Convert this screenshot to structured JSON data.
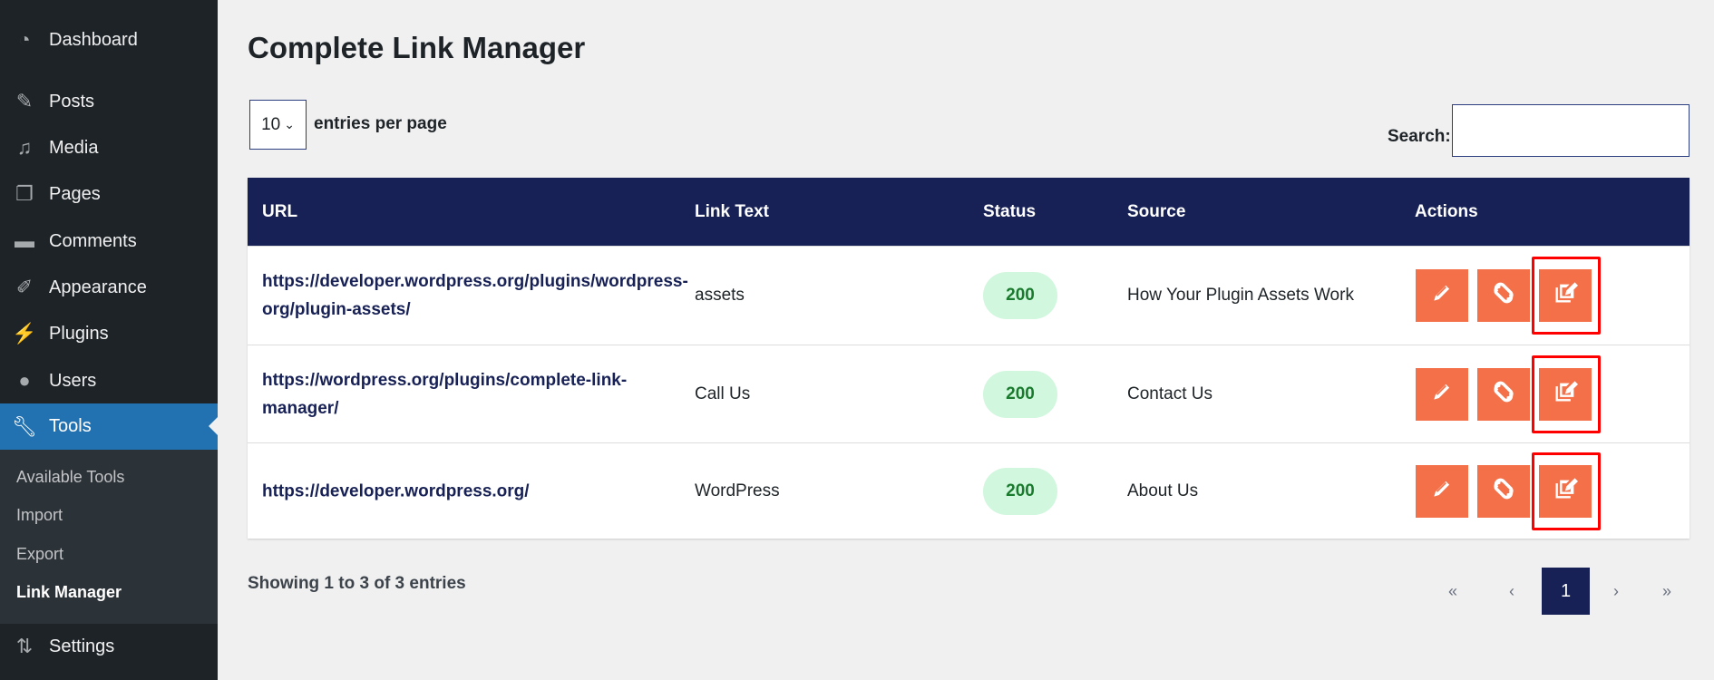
{
  "sidebar": {
    "items": [
      {
        "label": "Dashboard",
        "icon": "dashboard-icon"
      },
      {
        "label": "Posts",
        "icon": "pin-icon"
      },
      {
        "label": "Media",
        "icon": "media-icon"
      },
      {
        "label": "Pages",
        "icon": "pages-icon"
      },
      {
        "label": "Comments",
        "icon": "comment-icon"
      },
      {
        "label": "Appearance",
        "icon": "brush-icon"
      },
      {
        "label": "Plugins",
        "icon": "plugin-icon"
      },
      {
        "label": "Users",
        "icon": "user-icon"
      },
      {
        "label": "Tools",
        "icon": "wrench-icon"
      },
      {
        "label": "Settings",
        "icon": "settings-icon"
      }
    ],
    "submenu": [
      "Available Tools",
      "Import",
      "Export",
      "Link Manager"
    ]
  },
  "page": {
    "title": "Complete Link Manager",
    "per_page": "10",
    "per_page_label": "entries per page",
    "search_label": "Search:",
    "search_value": ""
  },
  "table": {
    "headers": [
      "URL",
      "Link Text",
      "Status",
      "Source",
      "Actions"
    ],
    "rows": [
      {
        "url": "https://developer.wordpress.org/plugins/wordpress-org/plugin-assets/",
        "text": "assets",
        "status": "200",
        "source": "How Your Plugin Assets Work"
      },
      {
        "url": "https://wordpress.org/plugins/complete-link-manager/",
        "text": "Call Us",
        "status": "200",
        "source": "Contact Us"
      },
      {
        "url": "https://developer.wordpress.org/",
        "text": "WordPress",
        "status": "200",
        "source": "About Us"
      }
    ]
  },
  "footer": {
    "showing": "Showing 1 to 3 of 3 entries",
    "pagination": {
      "first": "«",
      "prev": "‹",
      "current": "1",
      "next": "›",
      "last": "»"
    }
  },
  "colors": {
    "header": "#172155",
    "action": "#f37048",
    "badge": "#d1f7de"
  }
}
